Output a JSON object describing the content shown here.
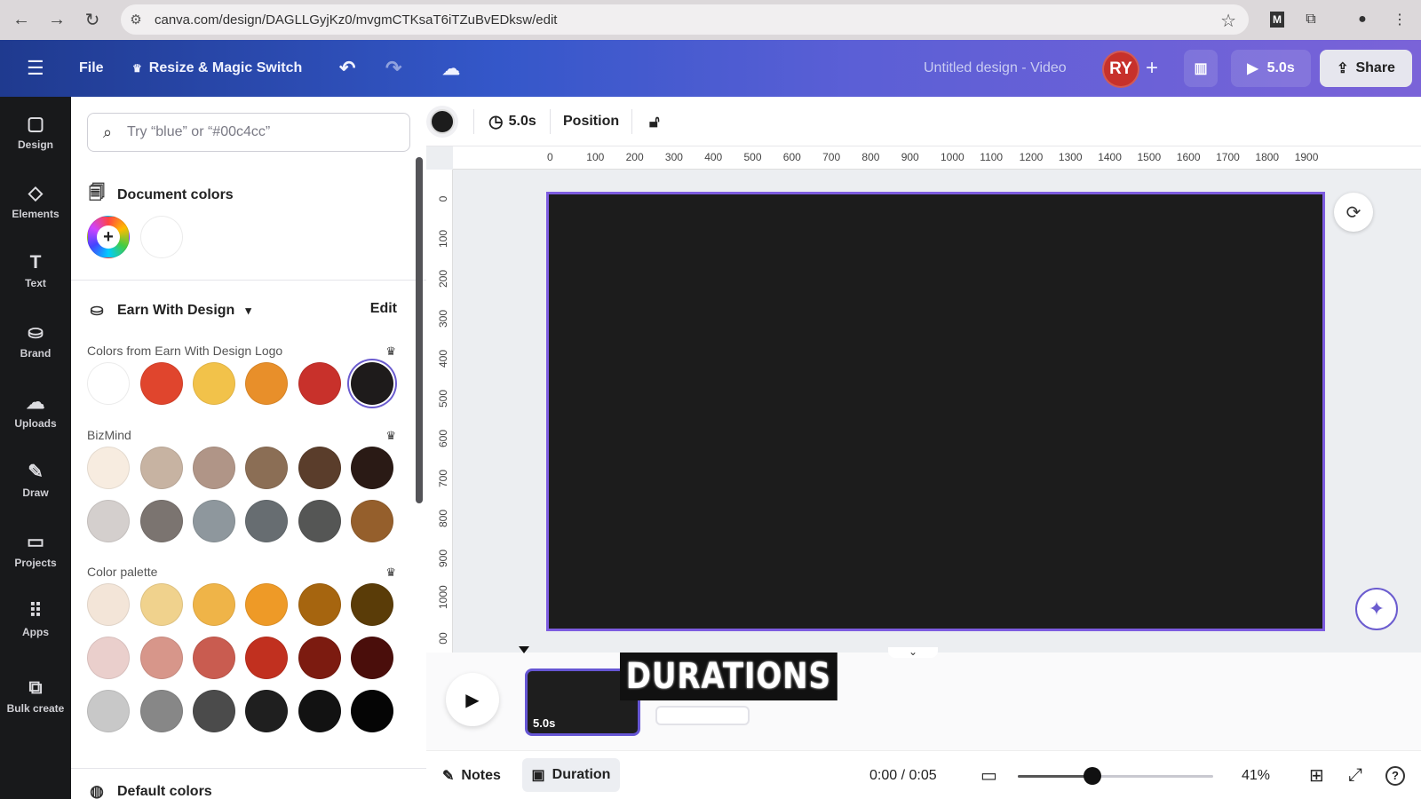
{
  "browser": {
    "url": "canva.com/design/DAGLLGyjKz0/mvgmCTKsaT6iTZuBvEDksw/edit"
  },
  "header": {
    "menu_icon": "hamburger-icon",
    "file_label": "File",
    "resize_label": "Resize & Magic Switch",
    "design_title": "Untitled design - Video",
    "avatar_initials": "RY",
    "play_duration": "5.0s",
    "share_label": "Share"
  },
  "rail": {
    "items": [
      {
        "label": "Design",
        "icon": "layout-icon"
      },
      {
        "label": "Elements",
        "icon": "shapes-icon"
      },
      {
        "label": "Text",
        "icon": "text-icon"
      },
      {
        "label": "Brand",
        "icon": "brand-icon"
      },
      {
        "label": "Uploads",
        "icon": "cloud-upload-icon"
      },
      {
        "label": "Draw",
        "icon": "pen-icon"
      },
      {
        "label": "Projects",
        "icon": "folder-icon"
      },
      {
        "label": "Apps",
        "icon": "grid-icon"
      },
      {
        "label": "Bulk create",
        "icon": "bulk-create-icon"
      }
    ]
  },
  "panel": {
    "search_placeholder": "Try “blue” or “#00c4cc”",
    "document_colors_title": "Document colors",
    "document_colors": [
      "#ffffff"
    ],
    "brand_kit_name": "Earn With Design",
    "edit_label": "Edit",
    "palettes": [
      {
        "title": "Colors from Earn With Design Logo",
        "colors": [
          "#ffffff",
          "#e0452d",
          "#f2c24a",
          "#e88f2a",
          "#c8312b",
          "#1e1b1b"
        ],
        "selected_index": 5
      },
      {
        "title": "BizMind",
        "colors": [
          "#f7ece0",
          "#c7b3a2",
          "#b09587",
          "#8b6e55",
          "#5a3d2b",
          "#2a1a15",
          "#d4cfcd",
          "#7b7470",
          "#8e979d",
          "#676d71",
          "#555655",
          "#955f2c"
        ]
      },
      {
        "title": "Color palette",
        "colors": [
          "#f3e5d8",
          "#f0d28d",
          "#efb448",
          "#ee9a27",
          "#a6650f",
          "#5a3c08",
          "#eacfcc",
          "#d7968a",
          "#c95c50",
          "#c1301f",
          "#7c1b10",
          "#4a0e0b",
          "#c8c8c8",
          "#878787",
          "#4b4b4b",
          "#1f1f1f",
          "#121212",
          "#050505"
        ]
      }
    ],
    "next_section_title": "Default colors"
  },
  "toolbar": {
    "fill_color": "#1c1c1c",
    "duration": "5.0s",
    "position_label": "Position"
  },
  "canvas": {
    "background": "#1c1c1c",
    "hruler_ticks": [
      "0",
      "100",
      "200",
      "300",
      "400",
      "500",
      "600",
      "700",
      "800",
      "900",
      "1000",
      "1100",
      "1200",
      "1300",
      "1400",
      "1500",
      "1600",
      "1700",
      "1800",
      "1900"
    ],
    "vruler_ticks": [
      "0",
      "100",
      "200",
      "300",
      "400",
      "500",
      "600",
      "700",
      "800",
      "900",
      "1000",
      "00"
    ]
  },
  "timeline": {
    "clip_duration": "5.0s",
    "overlay_title": "DURATIONS"
  },
  "bottom": {
    "notes_label": "Notes",
    "duration_label": "Duration",
    "time": "0:00 / 0:05",
    "zoom": "41%",
    "zoom_fraction": 0.38
  }
}
